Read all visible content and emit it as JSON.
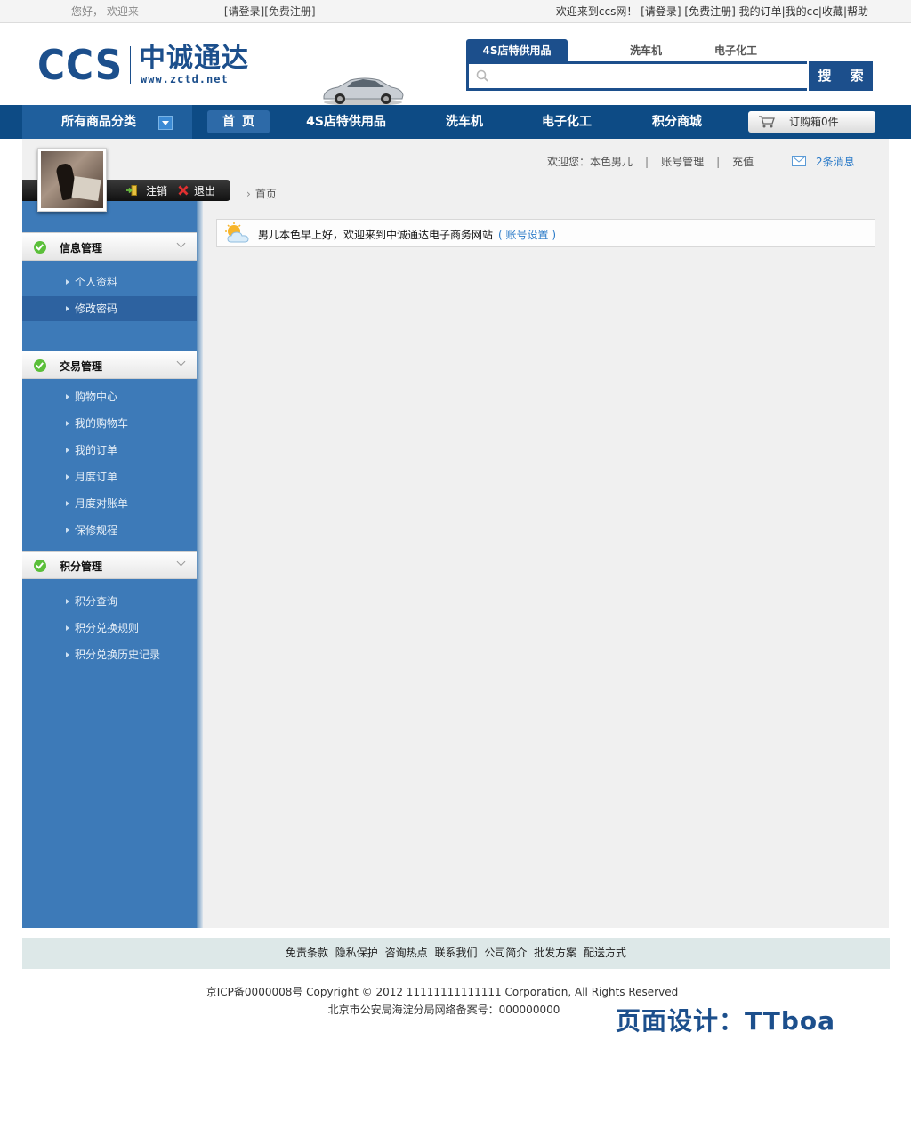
{
  "topbar": {
    "greeting": "您好，",
    "welcome_prefix": "欢迎来",
    "login_link": "[请登录]",
    "register_link": "[免费注册]",
    "right_welcome": "欢迎来到ccs网！",
    "right_login": "[请登录]",
    "right_register": "[免费注册]",
    "my_orders": "我的订单",
    "my_cc": "我的cc",
    "favorites": "收藏",
    "help": "帮助"
  },
  "logo": {
    "ccs": "CCS",
    "cn": "中诚通达",
    "url": "www.zctd.net"
  },
  "search": {
    "tabs": [
      "4S店特供用品",
      "洗车机",
      "电子化工"
    ],
    "placeholder": "",
    "button": "搜 索"
  },
  "nav": {
    "category": "所有商品分类",
    "items": [
      "首页",
      "4S店特供用品",
      "洗车机",
      "电子化工",
      "积分商城"
    ],
    "cart": "订购箱0件"
  },
  "user": {
    "logout_label": "注销",
    "exit_label": "退出",
    "welcome_user": "欢迎您：本色男儿",
    "account_mgmt": "账号管理",
    "recharge": "充值",
    "messages": "2条消息"
  },
  "breadcrumb": {
    "home": "首页"
  },
  "welcome_box": {
    "text": "男儿本色早上好，欢迎来到中诚通达电子商务网站",
    "link": "( 账号设置 )"
  },
  "sidebar": {
    "sections": [
      {
        "title": "信息管理",
        "items": [
          "个人资料",
          "修改密码"
        ]
      },
      {
        "title": "交易管理",
        "items": [
          "购物中心",
          "我的购物车",
          "我的订单",
          "月度订单",
          "月度对账单",
          "保修规程"
        ]
      },
      {
        "title": "积分管理",
        "items": [
          "积分查询",
          "积分兑换规则",
          "积分兑换历史记录"
        ]
      }
    ],
    "active_item": "修改密码"
  },
  "footer": {
    "links": [
      "免责条款",
      "隐私保护",
      "咨询热点",
      "联系我们",
      "公司简介",
      "批发方案",
      "配送方式"
    ],
    "copyright": "京ICP备0000008号 Copyright © 2012 11111111111111 Corporation, All Rights Reserved",
    "police": "北京市公安局海淀分局网络备案号：000000000",
    "design_credit": "页面设计：TTboa"
  },
  "colors": {
    "brand_blue": "#1c4f8c",
    "nav_blue": "#0d4b85",
    "sidebar_blue": "#3d7ab8",
    "link_blue": "#2a7ac8"
  }
}
